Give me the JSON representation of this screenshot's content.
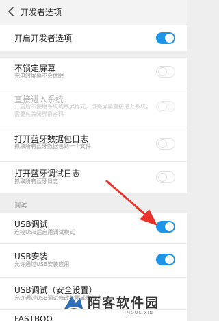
{
  "header": {
    "title": "开发者选项"
  },
  "settings": {
    "developer_options": {
      "title": "开启开发者选项",
      "state": "on"
    },
    "stay_awake": {
      "title": "不锁定屏幕",
      "subtitle": "充电时屏幕不会休眠",
      "state": "off"
    },
    "direct_boot": {
      "title": "直接进入系统",
      "subtitle": "开启后不使用系统的锁屏样式，点亮屏幕直接进入系统，需要先关闭屏幕密码",
      "state": "disabled"
    },
    "bt_hci_log": {
      "title": "打开蓝牙数据包日志",
      "subtitle": "抓取所有蓝牙数据包到一个文件",
      "state": "off"
    },
    "bt_debug_log": {
      "title": "打开蓝牙调试日志",
      "subtitle": "抓取所有蓝牙日志",
      "state": "off"
    }
  },
  "debug_section": {
    "label": "调试",
    "usb_debugging": {
      "title": "USB调试",
      "subtitle": "连接USB后启用调试模式",
      "state": "on"
    },
    "usb_install": {
      "title": "USB安装",
      "subtitle": "允许通过USB安装应用",
      "state": "on"
    },
    "usb_debug_security": {
      "title": "USB调试（安全设置）",
      "subtitle": "允许通过USB调试修改权限或模拟点击"
    },
    "fastboot": {
      "title": "FASTBOO"
    }
  },
  "watermark": {
    "name": "陌客软件园",
    "sub": "IMOOC XIN"
  },
  "colors": {
    "accent": "#1f95e8",
    "annotation_arrow": "#e8322a"
  },
  "icons": {
    "back": "chevron-left-icon",
    "arrow": "annotation-arrow"
  }
}
